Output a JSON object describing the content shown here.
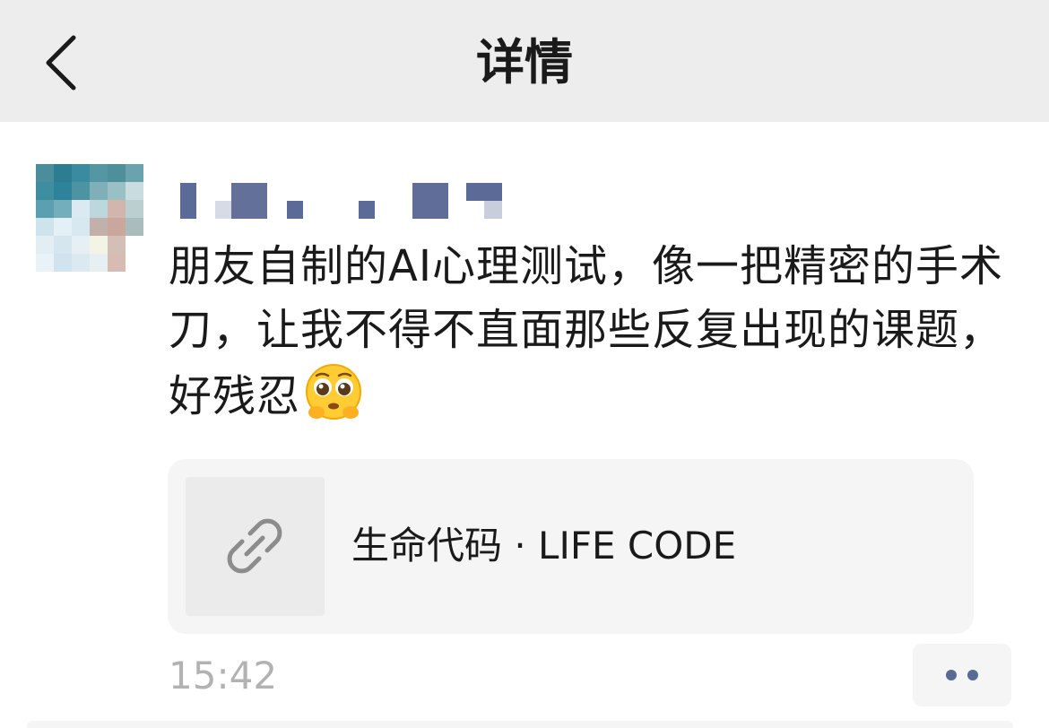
{
  "navbar": {
    "title": "详情",
    "back_icon": "chevron-left-icon"
  },
  "post": {
    "avatar": "pixelated-avatar",
    "author_name_display": "pixelated-name",
    "text": "朋友自制的AI心理测试，像一把精密的手术刀，让我不得不直面那些反复出现的课题，好残忍",
    "emoji": "pleading-face-emoji",
    "link_card": {
      "thumb_icon": "link-icon",
      "title": "生命代码 · LIFE CODE"
    },
    "time": "15:42",
    "more_icon": "more-dots-icon"
  },
  "colors": {
    "navbar_bg": "#ededed",
    "card_bg": "#f5f5f5",
    "timestamp": "#b2b2b2",
    "dots": "#576b95"
  }
}
